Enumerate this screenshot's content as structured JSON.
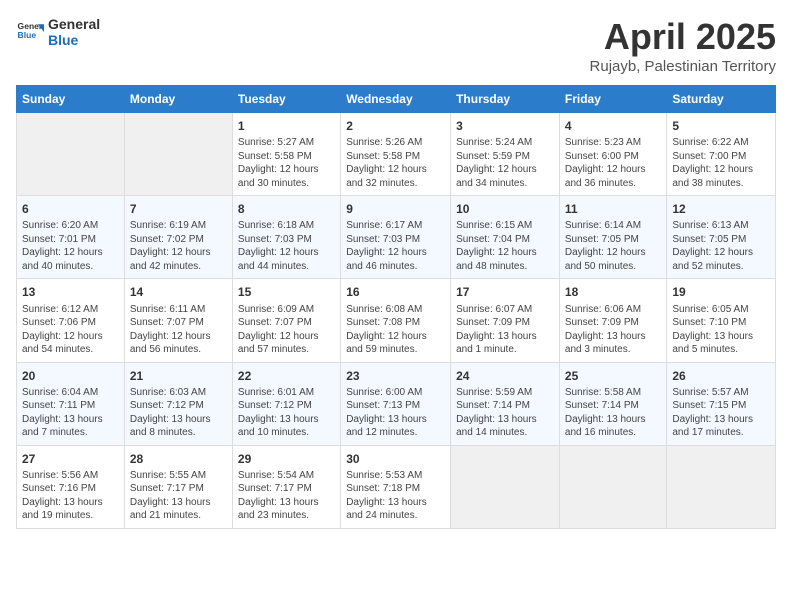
{
  "logo": {
    "line1": "General",
    "line2": "Blue"
  },
  "title": "April 2025",
  "subtitle": "Rujayb, Palestinian Territory",
  "days_header": [
    "Sunday",
    "Monday",
    "Tuesday",
    "Wednesday",
    "Thursday",
    "Friday",
    "Saturday"
  ],
  "weeks": [
    [
      {
        "day": "",
        "detail": ""
      },
      {
        "day": "",
        "detail": ""
      },
      {
        "day": "1",
        "detail": "Sunrise: 5:27 AM\nSunset: 5:58 PM\nDaylight: 12 hours\nand 30 minutes."
      },
      {
        "day": "2",
        "detail": "Sunrise: 5:26 AM\nSunset: 5:58 PM\nDaylight: 12 hours\nand 32 minutes."
      },
      {
        "day": "3",
        "detail": "Sunrise: 5:24 AM\nSunset: 5:59 PM\nDaylight: 12 hours\nand 34 minutes."
      },
      {
        "day": "4",
        "detail": "Sunrise: 5:23 AM\nSunset: 6:00 PM\nDaylight: 12 hours\nand 36 minutes."
      },
      {
        "day": "5",
        "detail": "Sunrise: 6:22 AM\nSunset: 7:00 PM\nDaylight: 12 hours\nand 38 minutes."
      }
    ],
    [
      {
        "day": "6",
        "detail": "Sunrise: 6:20 AM\nSunset: 7:01 PM\nDaylight: 12 hours\nand 40 minutes."
      },
      {
        "day": "7",
        "detail": "Sunrise: 6:19 AM\nSunset: 7:02 PM\nDaylight: 12 hours\nand 42 minutes."
      },
      {
        "day": "8",
        "detail": "Sunrise: 6:18 AM\nSunset: 7:03 PM\nDaylight: 12 hours\nand 44 minutes."
      },
      {
        "day": "9",
        "detail": "Sunrise: 6:17 AM\nSunset: 7:03 PM\nDaylight: 12 hours\nand 46 minutes."
      },
      {
        "day": "10",
        "detail": "Sunrise: 6:15 AM\nSunset: 7:04 PM\nDaylight: 12 hours\nand 48 minutes."
      },
      {
        "day": "11",
        "detail": "Sunrise: 6:14 AM\nSunset: 7:05 PM\nDaylight: 12 hours\nand 50 minutes."
      },
      {
        "day": "12",
        "detail": "Sunrise: 6:13 AM\nSunset: 7:05 PM\nDaylight: 12 hours\nand 52 minutes."
      }
    ],
    [
      {
        "day": "13",
        "detail": "Sunrise: 6:12 AM\nSunset: 7:06 PM\nDaylight: 12 hours\nand 54 minutes."
      },
      {
        "day": "14",
        "detail": "Sunrise: 6:11 AM\nSunset: 7:07 PM\nDaylight: 12 hours\nand 56 minutes."
      },
      {
        "day": "15",
        "detail": "Sunrise: 6:09 AM\nSunset: 7:07 PM\nDaylight: 12 hours\nand 57 minutes."
      },
      {
        "day": "16",
        "detail": "Sunrise: 6:08 AM\nSunset: 7:08 PM\nDaylight: 12 hours\nand 59 minutes."
      },
      {
        "day": "17",
        "detail": "Sunrise: 6:07 AM\nSunset: 7:09 PM\nDaylight: 13 hours\nand 1 minute."
      },
      {
        "day": "18",
        "detail": "Sunrise: 6:06 AM\nSunset: 7:09 PM\nDaylight: 13 hours\nand 3 minutes."
      },
      {
        "day": "19",
        "detail": "Sunrise: 6:05 AM\nSunset: 7:10 PM\nDaylight: 13 hours\nand 5 minutes."
      }
    ],
    [
      {
        "day": "20",
        "detail": "Sunrise: 6:04 AM\nSunset: 7:11 PM\nDaylight: 13 hours\nand 7 minutes."
      },
      {
        "day": "21",
        "detail": "Sunrise: 6:03 AM\nSunset: 7:12 PM\nDaylight: 13 hours\nand 8 minutes."
      },
      {
        "day": "22",
        "detail": "Sunrise: 6:01 AM\nSunset: 7:12 PM\nDaylight: 13 hours\nand 10 minutes."
      },
      {
        "day": "23",
        "detail": "Sunrise: 6:00 AM\nSunset: 7:13 PM\nDaylight: 13 hours\nand 12 minutes."
      },
      {
        "day": "24",
        "detail": "Sunrise: 5:59 AM\nSunset: 7:14 PM\nDaylight: 13 hours\nand 14 minutes."
      },
      {
        "day": "25",
        "detail": "Sunrise: 5:58 AM\nSunset: 7:14 PM\nDaylight: 13 hours\nand 16 minutes."
      },
      {
        "day": "26",
        "detail": "Sunrise: 5:57 AM\nSunset: 7:15 PM\nDaylight: 13 hours\nand 17 minutes."
      }
    ],
    [
      {
        "day": "27",
        "detail": "Sunrise: 5:56 AM\nSunset: 7:16 PM\nDaylight: 13 hours\nand 19 minutes."
      },
      {
        "day": "28",
        "detail": "Sunrise: 5:55 AM\nSunset: 7:17 PM\nDaylight: 13 hours\nand 21 minutes."
      },
      {
        "day": "29",
        "detail": "Sunrise: 5:54 AM\nSunset: 7:17 PM\nDaylight: 13 hours\nand 23 minutes."
      },
      {
        "day": "30",
        "detail": "Sunrise: 5:53 AM\nSunset: 7:18 PM\nDaylight: 13 hours\nand 24 minutes."
      },
      {
        "day": "",
        "detail": ""
      },
      {
        "day": "",
        "detail": ""
      },
      {
        "day": "",
        "detail": ""
      }
    ]
  ]
}
